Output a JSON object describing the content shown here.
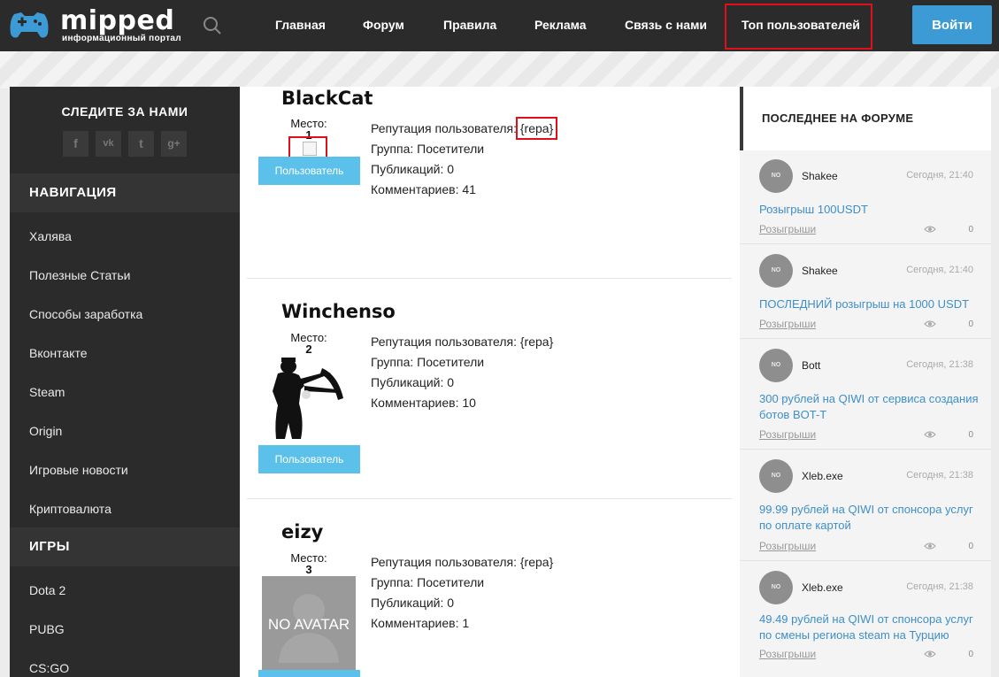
{
  "header": {
    "logo_text": "mipped",
    "logo_subtitle": "информационный портал",
    "nav": [
      "Главная",
      "Форум",
      "Правила",
      "Реклама",
      "Связь с нами",
      "Топ пользователей"
    ],
    "login_label": "Войти"
  },
  "sidebar": {
    "follow_title": "СЛЕДИТЕ ЗА НАМИ",
    "social": [
      "f",
      "vk",
      "t",
      "g+"
    ],
    "nav_title": "НАВИГАЦИЯ",
    "nav_items": [
      "Халява",
      "Полезные Статьи",
      "Способы заработка",
      "Вконтакте",
      "Steam",
      "Origin",
      "Игровые новости",
      "Криптовалюта"
    ],
    "games_title": "ИГРЫ",
    "game_items": [
      "Dota 2",
      "PUBG",
      "CS:GO"
    ]
  },
  "main": {
    "place_label": "Место:",
    "group_button": "Пользователь",
    "users": [
      {
        "name": "BlackCat",
        "place": "1",
        "reputation": "Репутация пользователя: {repa}",
        "group": "Группа: Посетители",
        "publications": "Публикаций: 0",
        "comments": "Комментариев: 41"
      },
      {
        "name": "Winchenso",
        "place": "2",
        "reputation": "Репутация пользователя: {repa}",
        "group": "Группа: Посетители",
        "publications": "Публикаций: 0",
        "comments": "Комментариев: 10"
      },
      {
        "name": "eizy",
        "place": "3",
        "reputation": "Репутация пользователя: {repa}",
        "group": "Группа: Посетители",
        "publications": "Публикаций: 0",
        "comments": "Комментариев: 1",
        "avatar_text": "NO AVATAR"
      }
    ]
  },
  "forum": {
    "title": "ПОСЛЕДНЕЕ НА ФОРУМЕ",
    "avatar_text": "NO AVATAR",
    "posts": [
      {
        "author": "Shakee",
        "time": "Сегодня, 21:40",
        "title": "Розыгрыш 100USDT",
        "category": "Розыгрыши",
        "views": "0"
      },
      {
        "author": "Shakee",
        "time": "Сегодня, 21:40",
        "title": "ПОСЛЕДНИЙ розыгрыш на 1000 USDT",
        "category": "Розыгрыши",
        "views": "0"
      },
      {
        "author": "Bott",
        "time": "Сегодня, 21:38",
        "title": "300 рублей на QIWI от сервиса создания ботов BOT-T",
        "category": "Розыгрыши",
        "views": "0"
      },
      {
        "author": "Xleb.exe",
        "time": "Сегодня, 21:38",
        "title": "99.99 рублей на QIWI от спонсора услуг по оплате картой",
        "category": "Розыгрыши",
        "views": "0"
      },
      {
        "author": "Xleb.exe",
        "time": "Сегодня, 21:38",
        "title": "49.49 рублей на QIWI от спонсора услуг по смены региона steam на Турцию",
        "category": "Розыгрыши",
        "views": "0"
      }
    ]
  }
}
